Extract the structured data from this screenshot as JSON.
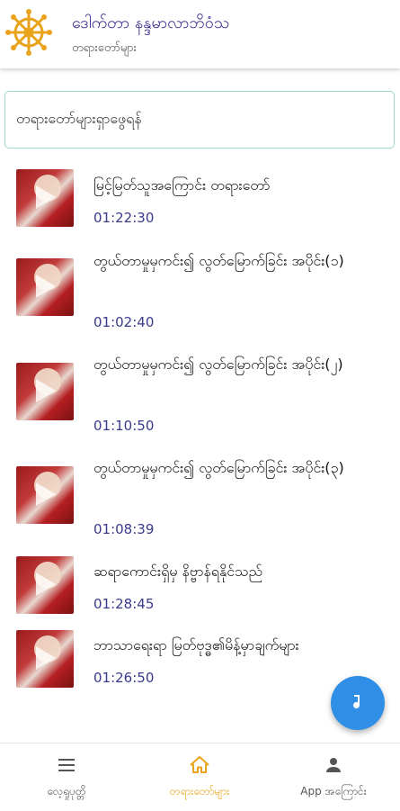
{
  "header": {
    "title": "ဒေါက်တာ နန္ဒမာလာဘိဝံသ",
    "subtitle": "တရားတော်များ",
    "logo_icon": "dharma-wheel-icon"
  },
  "search": {
    "placeholder": "တရားတော်များရှာဖွေရန်"
  },
  "items": [
    {
      "title": "မြင့်မြတ်သူအကြောင်း တရားတော်",
      "duration": "01:22:30"
    },
    {
      "title": "တွယ်တာမှုမှကင်း၍ လွတ်မြောက်ခြင်း အပိုင်း(၁)",
      "duration": "01:02:40"
    },
    {
      "title": "တွယ်တာမှုမှကင်း၍ လွတ်မြောက်ခြင်း အပိုင်း(၂)",
      "duration": "01:10:50"
    },
    {
      "title": "တွယ်တာမှုမှကင်း၍ လွတ်မြောက်ခြင်း အပိုင်း(၃)",
      "duration": "01:08:39"
    },
    {
      "title": "ဆရာကောင်းရှိမှ နိဗ္ဗာန်ရနိုင်သည်",
      "duration": "01:28:45"
    },
    {
      "title": "ဘာသာရေးရာ မြတ်ဗုဒ္ဓ၏မိန့်မှာချက်များ",
      "duration": "01:26:50"
    }
  ],
  "fab": {
    "icon": "music-note-icon"
  },
  "nav": {
    "items": [
      {
        "label": "လေ့ရှုပုတ္တိ",
        "icon": "menu-icon",
        "active": false
      },
      {
        "label": "တရားတော်များ",
        "icon": "home-icon",
        "active": true
      },
      {
        "label": "App အကြောင်း",
        "icon": "person-icon",
        "active": false
      }
    ],
    "active_color": "#e8a31b"
  },
  "colors": {
    "title": "#3a2a8c",
    "duration": "#3a3a8c",
    "search_border": "#9ed7cd",
    "fab": "#2f8fe6"
  }
}
